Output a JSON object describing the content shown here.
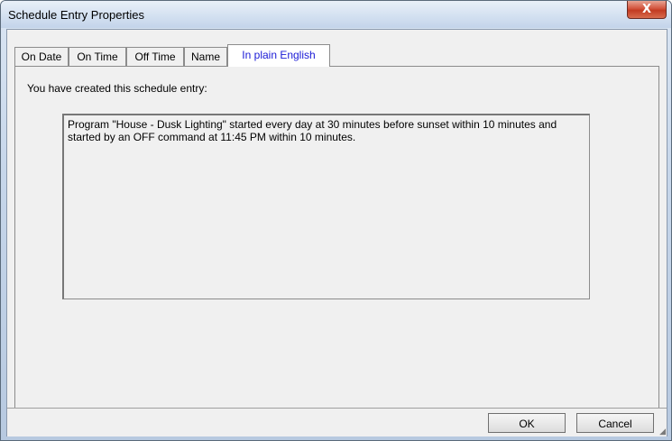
{
  "window": {
    "title": "Schedule Entry Properties",
    "close_glyph": "X"
  },
  "tabs": [
    {
      "label": "On Date",
      "active": false
    },
    {
      "label": "On Time",
      "active": false
    },
    {
      "label": "Off Time",
      "active": false
    },
    {
      "label": "Name",
      "active": false
    },
    {
      "label": "In plain English",
      "active": true
    }
  ],
  "panel": {
    "intro": "You have created this schedule entry:",
    "description": "Program \"House - Dusk Lighting\" started every day at 30 minutes before sunset within 10 minutes and started by an OFF command at 11:45 PM within 10 minutes."
  },
  "buttons": {
    "ok": "OK",
    "cancel": "Cancel"
  },
  "colors": {
    "active_tab_text": "#1a1ad6",
    "dialog_bg": "#f0f0f0",
    "close_button": "#c23b22"
  }
}
